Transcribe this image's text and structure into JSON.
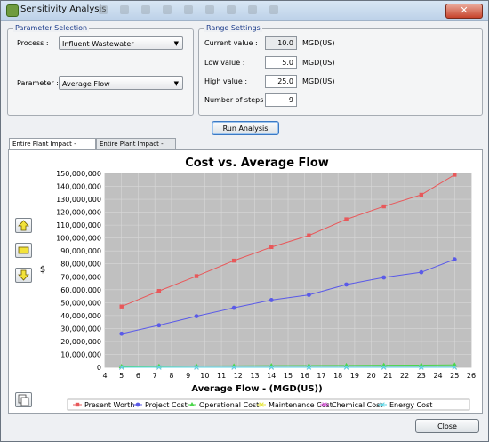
{
  "window": {
    "title": "Sensitivity Analysis",
    "close_glyph": "✕"
  },
  "parameter_selection": {
    "title": "Parameter Selection",
    "process_label": "Process :",
    "process_value": "Influent Wastewater",
    "parameter_label": "Parameter :",
    "parameter_value": "Average Flow"
  },
  "range_settings": {
    "title": "Range Settings",
    "current_label": "Current value :",
    "current_value": "10.0",
    "low_label": "Low value :",
    "low_value": "5.0",
    "high_label": "High value :",
    "high_value": "25.0",
    "steps_label": "Number of steps :",
    "steps_value": "9",
    "unit": "MGD(US)"
  },
  "run_button": "Run Analysis",
  "tabs": [
    {
      "label": "Entire Plant Impact - graph"
    },
    {
      "label": "Entire Plant Impact - table"
    }
  ],
  "close_button": "Close",
  "icons": {
    "up": "arrow-up-icon",
    "reset": "rectangle-icon",
    "down": "arrow-down-icon",
    "copy": "copy-icon"
  },
  "chart_data": {
    "type": "line",
    "title": "Cost vs. Average Flow",
    "xlabel": "Average Flow -  (MGD(US))",
    "ylabel": "$",
    "xlim": [
      4,
      26
    ],
    "ylim": [
      0,
      150000000
    ],
    "x_ticks": [
      4,
      5,
      6,
      7,
      8,
      9,
      10,
      11,
      12,
      13,
      14,
      15,
      16,
      17,
      18,
      19,
      20,
      21,
      22,
      23,
      24,
      25,
      26
    ],
    "y_ticks": [
      0,
      10000000,
      20000000,
      30000000,
      40000000,
      50000000,
      60000000,
      70000000,
      80000000,
      90000000,
      100000000,
      110000000,
      120000000,
      130000000,
      140000000,
      150000000
    ],
    "y_tick_labels": [
      "0",
      "10,000,000",
      "20,000,000",
      "30,000,000",
      "40,000,000",
      "50,000,000",
      "60,000,000",
      "70,000,000",
      "80,000,000",
      "90,000,000",
      "100,000,000",
      "110,000,000",
      "120,000,000",
      "130,000,000",
      "140,000,000",
      "150,000,000"
    ],
    "grid": true,
    "legend_placement": "bottom",
    "x": [
      5,
      7.25,
      9.5,
      11.75,
      14,
      16.25,
      18.5,
      20.75,
      23,
      25
    ],
    "series": [
      {
        "name": "Present Worth",
        "color": "#e8585a",
        "marker": "square",
        "values": [
          47000000,
          59000000,
          70500000,
          82500000,
          93000000,
          102000000,
          114500000,
          124500000,
          133500000,
          149000000
        ]
      },
      {
        "name": "Project Cost",
        "color": "#5a5ae8",
        "marker": "circle",
        "values": [
          26000000,
          32500000,
          39500000,
          46000000,
          52000000,
          56000000,
          64000000,
          69500000,
          73500000,
          83500000
        ]
      },
      {
        "name": "Operational Cost",
        "color": "#4ad64a",
        "marker": "triangle",
        "values": [
          700000,
          900000,
          1000000,
          1100000,
          1300000,
          1400000,
          1500000,
          1600000,
          1700000,
          1900000
        ]
      },
      {
        "name": "Maintenance Cost",
        "color": "#e6e63a",
        "marker": "cross",
        "values": [
          0,
          0,
          0,
          0,
          0,
          0,
          0,
          0,
          0,
          0
        ]
      },
      {
        "name": "Chemical Cost",
        "color": "#e05ae0",
        "marker": "cross",
        "values": [
          0,
          0,
          0,
          0,
          0,
          0,
          0,
          0,
          0,
          0
        ]
      },
      {
        "name": "Energy Cost",
        "color": "#5ad6e6",
        "marker": "cross",
        "values": [
          0,
          0,
          0,
          0,
          0,
          0,
          0,
          0,
          0,
          0
        ]
      }
    ]
  }
}
